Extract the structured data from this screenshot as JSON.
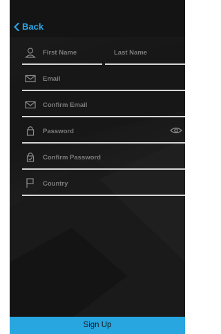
{
  "header": {
    "back_label": "Back"
  },
  "form": {
    "first_name_placeholder": "First Name",
    "last_name_placeholder": "Last Name",
    "email_placeholder": "Email",
    "confirm_email_placeholder": "Confirm Email",
    "password_placeholder": "Password",
    "confirm_password_placeholder": "Confirm Password",
    "country_placeholder": "Country"
  },
  "footer": {
    "signup_label": "Sign Up"
  },
  "colors": {
    "accent": "#27a6e0",
    "background": "#181818",
    "field_line": "#d7d7d7",
    "placeholder": "#7c7c7c"
  }
}
